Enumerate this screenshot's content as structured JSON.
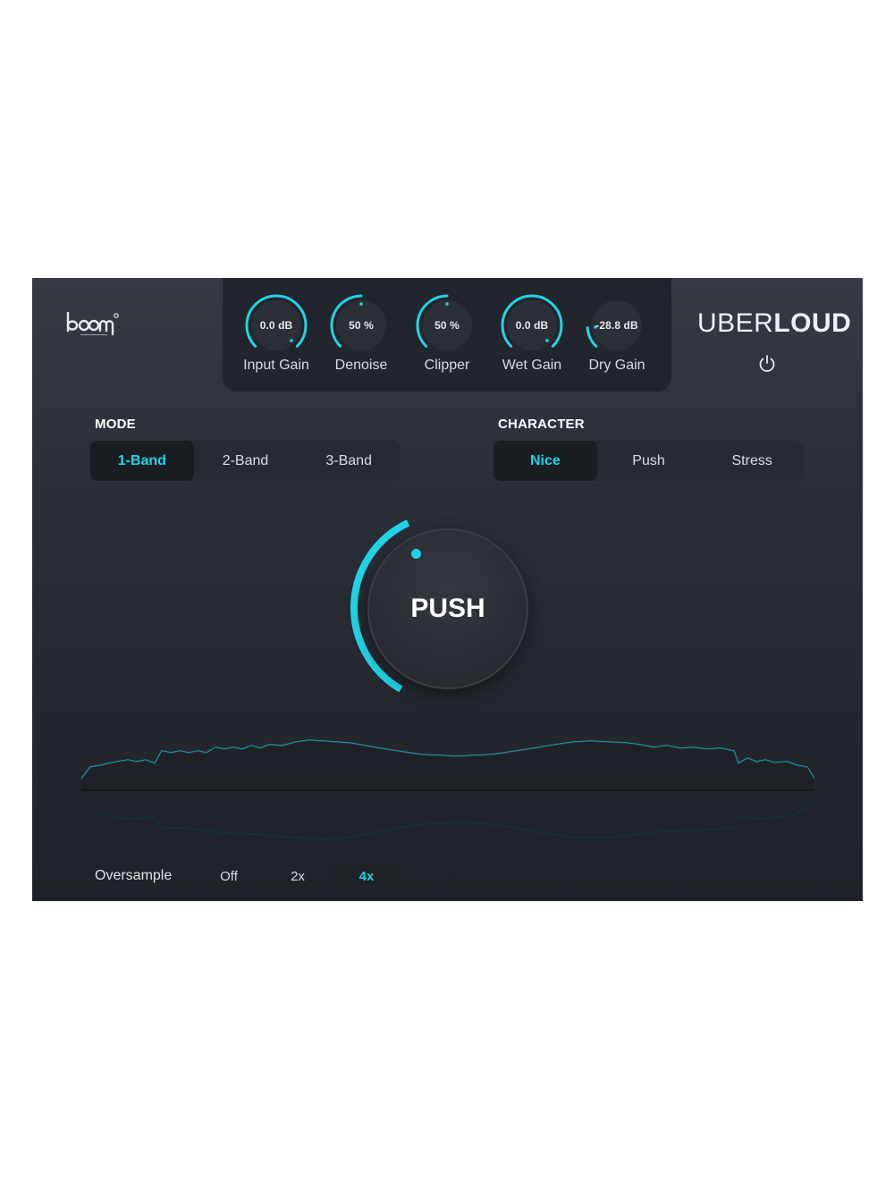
{
  "brand": {
    "logo_icon": "boom-logo",
    "title_thin": "UBER",
    "title_bold": "LOUD",
    "power_icon": "power-icon"
  },
  "knobs": [
    {
      "value": "0.0 dB",
      "label": "Input Gain",
      "level": 1.0
    },
    {
      "value": "50 %",
      "label": "Denoise",
      "level": 0.5
    },
    {
      "value": "50 %",
      "label": "Clipper",
      "level": 0.5
    },
    {
      "value": "0.0 dB",
      "label": "Wet Gain",
      "level": 1.0
    },
    {
      "value": "-28.8 dB",
      "label": "Dry Gain",
      "level": 0.15
    }
  ],
  "mode": {
    "label": "MODE",
    "options": [
      "1-Band",
      "2-Band",
      "3-Band"
    ],
    "selected": "1-Band"
  },
  "character": {
    "label": "CHARACTER",
    "options": [
      "Nice",
      "Push",
      "Stress"
    ],
    "selected": "Nice"
  },
  "push": {
    "label": "PUSH",
    "level": 0.35
  },
  "oversample": {
    "label": "Oversample",
    "options": [
      "Off",
      "2x",
      "4x"
    ],
    "selected": "4x"
  },
  "colors": {
    "accent": "#22d3e6",
    "panel": "#22252c",
    "background": "#2a2e36"
  }
}
